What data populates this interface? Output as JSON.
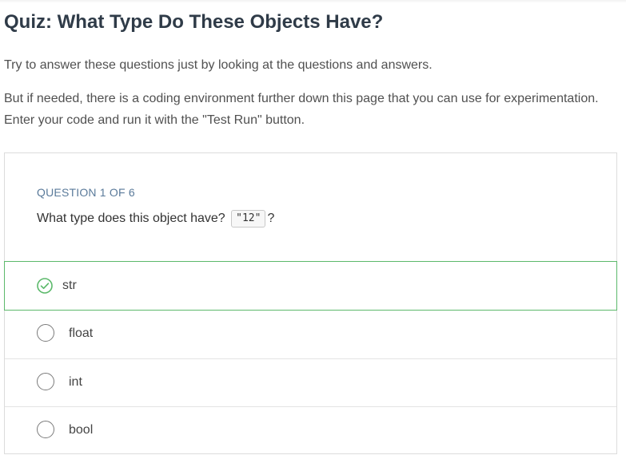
{
  "page": {
    "title": "Quiz: What Type Do These Objects Have?",
    "intro_1": "Try to answer these questions just by looking at the questions and answers.",
    "intro_2": "But if needed, there is a coding environment further down this page that you can use for experimentation. Enter your code and run it with the \"Test Run\" button."
  },
  "quiz": {
    "counter": "QUESTION 1 OF 6",
    "question_prefix": "What type does this object have?",
    "question_code": "\"12\"",
    "question_suffix": "?",
    "answers": [
      {
        "label": "str",
        "state": "correct",
        "icon": "check-circle-icon"
      },
      {
        "label": "float",
        "state": "unselected",
        "icon": "radio-circle-icon"
      },
      {
        "label": "int",
        "state": "unselected",
        "icon": "radio-circle-icon"
      },
      {
        "label": "bool",
        "state": "unselected",
        "icon": "radio-circle-icon"
      }
    ]
  },
  "colors": {
    "correct": "#5cb96b",
    "title": "#2f3b48",
    "counter": "#5a7a9a"
  }
}
